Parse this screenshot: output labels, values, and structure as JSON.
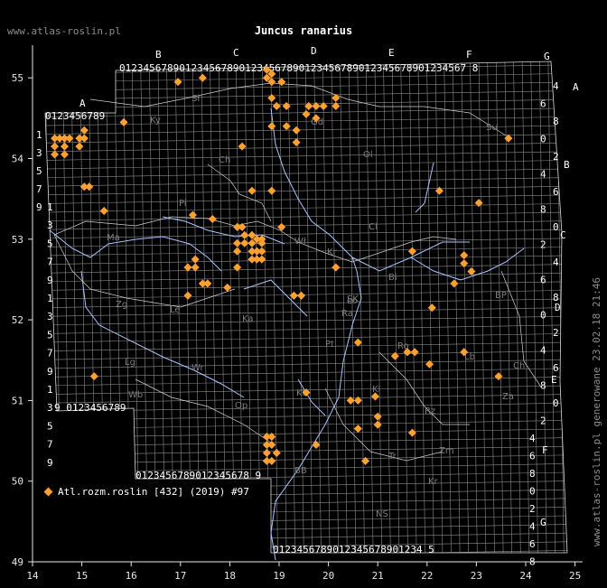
{
  "header": {
    "site": "www.atlas-roslin.pl",
    "title": "Juncus ranarius"
  },
  "side_note": "www.atlas-roslin.pl generowane 23.02.18 21:46",
  "legend": {
    "label": "Atl.rozm.roslin [432] (2019) #97"
  },
  "colors": {
    "marker": "#ffa030",
    "grid": "#8a8a8a",
    "river": "#a7c4ff"
  },
  "axes": {
    "x_ticks": [
      "14",
      "15",
      "16",
      "17",
      "18",
      "19",
      "20",
      "21",
      "22",
      "23",
      "24",
      "25"
    ],
    "y_ticks": [
      "49",
      "50",
      "51",
      "52",
      "53",
      "54",
      "55"
    ]
  },
  "grid_letters_top": [
    "B",
    "C",
    "D",
    "E",
    "F",
    "G"
  ],
  "grid_letters_right": [
    "A",
    "B",
    "C",
    "D",
    "E",
    "F",
    "G"
  ],
  "grid_letters_left": [
    "A"
  ],
  "digit_rows": {
    "top": "0123456789012345678901234567890123456789012345678901234567 8",
    "a_top": "0123456789",
    "a_bottom": "9 0123456789",
    "bottom_mid": "0123456789012345678 9",
    "bottom_low": "0123456789012345678901234 5",
    "a_left": [
      "1",
      "3",
      "5",
      "7",
      "9"
    ],
    "mid_left": [
      "1",
      "3",
      "5",
      "7",
      "9",
      "1",
      "3",
      "5",
      "7",
      "9",
      "1",
      "3",
      "5",
      "7",
      "9"
    ],
    "right": [
      "4",
      "6",
      "8",
      "0",
      "2",
      "4",
      "6",
      "8",
      "0",
      "2",
      "4",
      "6",
      "8",
      "0",
      "2",
      "4",
      "6",
      "8",
      "0",
      "2",
      "4",
      "6",
      "8",
      "0",
      "2",
      "4",
      "6",
      "8"
    ]
  },
  "region_labels": [
    "Sł",
    "Ky",
    "Ch",
    "Gd",
    "Ol",
    "Su",
    "Pi",
    "Ci",
    "Ma",
    "Wł",
    "Kr",
    "Ło",
    "SK",
    "Zg",
    "Le",
    "Bi",
    "BP",
    "Ka",
    "Ra",
    "Pt",
    "Ro",
    "Lb",
    "Ch",
    "Lg",
    "Wr",
    "Wb",
    "Op",
    "Kt",
    "Kl",
    "Rz",
    "Za",
    "Zm",
    "BB",
    "Tr",
    "NS",
    "Kr"
  ],
  "observations": [
    [
      14.45,
      54.25
    ],
    [
      14.55,
      54.25
    ],
    [
      14.65,
      54.25
    ],
    [
      14.75,
      54.25
    ],
    [
      14.95,
      54.25
    ],
    [
      15.05,
      54.35
    ],
    [
      15.05,
      54.25
    ],
    [
      14.45,
      54.15
    ],
    [
      14.65,
      54.15
    ],
    [
      14.95,
      54.15
    ],
    [
      14.45,
      54.05
    ],
    [
      14.65,
      54.05
    ],
    [
      15.85,
      54.45
    ],
    [
      15.05,
      53.65
    ],
    [
      15.15,
      53.65
    ],
    [
      15.45,
      53.35
    ],
    [
      17.25,
      53.3
    ],
    [
      17.65,
      53.25
    ],
    [
      18.15,
      53.15
    ],
    [
      18.25,
      53.15
    ],
    [
      18.3,
      53.05
    ],
    [
      18.45,
      53.05
    ],
    [
      18.55,
      53.0
    ],
    [
      18.65,
      53.0
    ],
    [
      18.15,
      52.95
    ],
    [
      18.3,
      52.95
    ],
    [
      18.45,
      52.95
    ],
    [
      18.65,
      52.95
    ],
    [
      18.15,
      52.85
    ],
    [
      18.45,
      52.85
    ],
    [
      18.55,
      52.85
    ],
    [
      18.65,
      52.85
    ],
    [
      18.45,
      52.75
    ],
    [
      18.55,
      52.75
    ],
    [
      18.65,
      52.75
    ],
    [
      18.15,
      52.65
    ],
    [
      17.3,
      52.75
    ],
    [
      17.15,
      52.65
    ],
    [
      17.3,
      52.65
    ],
    [
      17.45,
      52.45
    ],
    [
      17.55,
      52.45
    ],
    [
      17.95,
      52.4
    ],
    [
      17.15,
      52.3
    ],
    [
      19.3,
      52.3
    ],
    [
      19.45,
      52.3
    ],
    [
      20.15,
      52.65
    ],
    [
      21.7,
      52.85
    ],
    [
      22.75,
      52.8
    ],
    [
      22.75,
      52.7
    ],
    [
      22.9,
      52.6
    ],
    [
      22.55,
      52.45
    ],
    [
      22.1,
      52.15
    ],
    [
      20.6,
      51.72
    ],
    [
      21.35,
      51.55
    ],
    [
      21.6,
      51.6
    ],
    [
      21.75,
      51.6
    ],
    [
      22.05,
      51.45
    ],
    [
      22.75,
      51.6
    ],
    [
      23.45,
      51.3
    ],
    [
      15.25,
      51.3
    ],
    [
      19.55,
      51.1
    ],
    [
      20.45,
      51.0
    ],
    [
      20.6,
      51.0
    ],
    [
      20.95,
      51.05
    ],
    [
      21.0,
      50.8
    ],
    [
      21.0,
      50.7
    ],
    [
      21.7,
      50.6
    ],
    [
      20.6,
      50.65
    ],
    [
      18.75,
      50.55
    ],
    [
      18.85,
      50.55
    ],
    [
      18.75,
      50.45
    ],
    [
      18.85,
      50.45
    ],
    [
      18.75,
      50.35
    ],
    [
      18.95,
      50.35
    ],
    [
      18.75,
      50.25
    ],
    [
      18.85,
      50.25
    ],
    [
      19.75,
      50.45
    ],
    [
      20.75,
      50.25
    ],
    [
      16.95,
      54.95
    ],
    [
      17.45,
      55.0
    ],
    [
      18.75,
      55.1
    ],
    [
      18.75,
      55.0
    ],
    [
      18.85,
      55.05
    ],
    [
      18.85,
      54.95
    ],
    [
      19.05,
      54.95
    ],
    [
      18.85,
      54.75
    ],
    [
      18.95,
      54.65
    ],
    [
      19.15,
      54.65
    ],
    [
      19.6,
      54.65
    ],
    [
      19.75,
      54.65
    ],
    [
      19.9,
      54.65
    ],
    [
      19.55,
      54.55
    ],
    [
      19.75,
      54.5
    ],
    [
      20.15,
      54.75
    ],
    [
      20.15,
      54.65
    ],
    [
      18.85,
      54.4
    ],
    [
      19.15,
      54.4
    ],
    [
      19.35,
      54.35
    ],
    [
      19.35,
      54.2
    ],
    [
      18.25,
      54.15
    ],
    [
      18.45,
      53.6
    ],
    [
      18.85,
      53.6
    ],
    [
      19.05,
      53.15
    ],
    [
      22.25,
      53.6
    ],
    [
      23.05,
      53.45
    ],
    [
      23.65,
      54.25
    ]
  ]
}
